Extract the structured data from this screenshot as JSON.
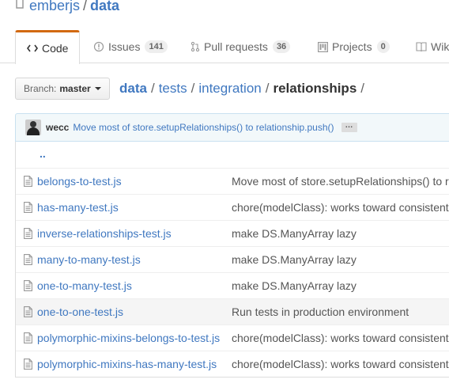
{
  "repo": {
    "owner": "emberjs",
    "separator": "/",
    "name": "data"
  },
  "tabs": [
    {
      "label": "Code",
      "icon": "code-icon",
      "selected": true
    },
    {
      "label": "Issues",
      "icon": "issue-opened-icon",
      "count": "141"
    },
    {
      "label": "Pull requests",
      "icon": "git-pull-request-icon",
      "count": "36"
    },
    {
      "label": "Projects",
      "icon": "project-icon",
      "count": "0"
    },
    {
      "label": "Wiki",
      "icon": "book-icon"
    }
  ],
  "branch": {
    "label": "Branch:",
    "value": "master"
  },
  "breadcrumb": {
    "root": "data",
    "links": [
      "tests",
      "integration"
    ],
    "final": "relationships",
    "separator": "/"
  },
  "latest_commit": {
    "author": "wecc",
    "message": "Move most of store.setupRelationships() to relationship.push()",
    "ellipsis": "…"
  },
  "files": {
    "up_label": "..",
    "rows": [
      {
        "name": "belongs-to-test.js",
        "message": "Move most of store.setupRelationships() to relationship.push()"
      },
      {
        "name": "has-many-test.js",
        "message": "chore(modelClass): works toward consistent usage of modelClass"
      },
      {
        "name": "inverse-relationships-test.js",
        "message": "make DS.ManyArray lazy"
      },
      {
        "name": "many-to-many-test.js",
        "message": "make DS.ManyArray lazy"
      },
      {
        "name": "one-to-many-test.js",
        "message": "make DS.ManyArray lazy"
      },
      {
        "name": "one-to-one-test.js",
        "message": "Run tests in production environment"
      },
      {
        "name": "polymorphic-mixins-belongs-to-test.js",
        "message": "chore(modelClass): works toward consistent usage of modelClass"
      },
      {
        "name": "polymorphic-mixins-has-many-test.js",
        "message": "chore(modelClass): works toward consistent usage of modelClass"
      }
    ]
  },
  "colors": {
    "link": "#4078c0",
    "tab_accent": "#d26911",
    "commit_bar": "#f2f8fa"
  }
}
